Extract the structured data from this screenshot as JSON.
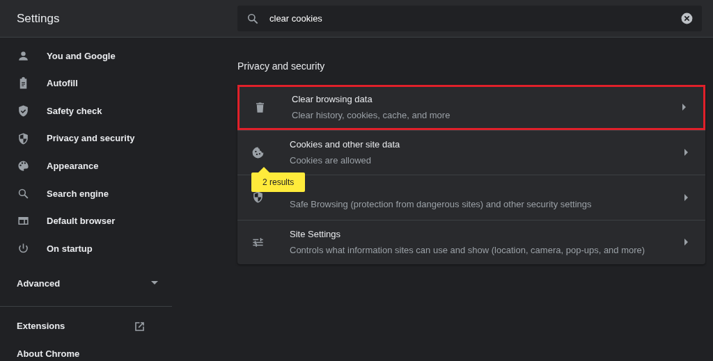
{
  "header": {
    "title": "Settings",
    "search": {
      "value": "clear cookies"
    }
  },
  "sidebar": {
    "items": [
      {
        "label": "You and Google"
      },
      {
        "label": "Autofill"
      },
      {
        "label": "Safety check"
      },
      {
        "label": "Privacy and security"
      },
      {
        "label": "Appearance"
      },
      {
        "label": "Search engine"
      },
      {
        "label": "Default browser"
      },
      {
        "label": "On startup"
      }
    ],
    "advanced": {
      "label": "Advanced",
      "expanded": false
    },
    "footer_items": [
      {
        "label": "Extensions"
      },
      {
        "label": "About Chrome"
      }
    ]
  },
  "section": {
    "title": "Privacy and security",
    "rows": [
      {
        "title": "Clear browsing data",
        "subtitle": "Clear history, cookies, cache, and more",
        "highlighted": true
      },
      {
        "title": "Cookies and other site data",
        "subtitle": "Cookies are allowed",
        "highlighted": false
      },
      {
        "subtitle": "Safe Browsing (protection from dangerous sites) and other security settings",
        "highlighted": false
      },
      {
        "title": "Site Settings",
        "subtitle": "Controls what information sites can use and show (location, camera, pop-ups, and more)",
        "highlighted": false
      }
    ]
  },
  "tooltip": {
    "text": "2 results"
  }
}
